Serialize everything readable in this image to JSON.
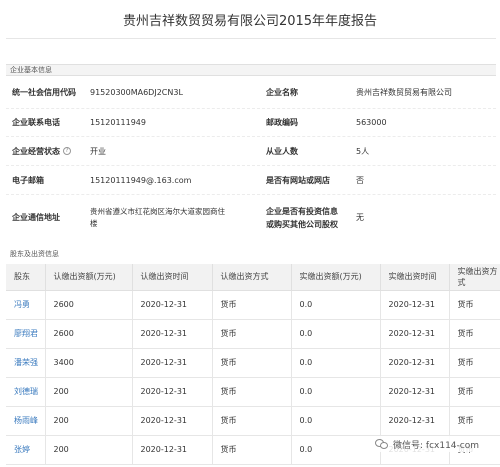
{
  "report_title": "贵州吉祥数贸贸易有限公司2015年年度报告",
  "basic": {
    "section_title": "企业基本信息",
    "credit_code_label": "统一社会信用代码",
    "credit_code_value": "91520300MA6DJ2CN3L",
    "company_name_label": "企业名称",
    "company_name_value": "贵州吉祥数贸贸易有限公司",
    "phone_label": "企业联系电话",
    "phone_value": "15120111949",
    "postcode_label": "邮政编码",
    "postcode_value": "563000",
    "status_label": "企业经营状态",
    "status_help": "?",
    "status_value": "开业",
    "employees_label": "从业人数",
    "employees_value": "5人",
    "email_label": "电子邮箱",
    "email_value": "15120111949@.163.com",
    "website_label": "是否有网站或网店",
    "website_value": "否",
    "address_label": "企业通信地址",
    "address_value_line1": "贵州省遵义市红花岗区海尔大道家园商住",
    "address_value_line2": "楼",
    "investment_label_line1": "企业是否有投资信息",
    "investment_label_line2": "或购买其他公司股权",
    "investment_value": "无"
  },
  "shareholders": {
    "section_title": "股东及出资信息",
    "headers": [
      "股东",
      "认缴出资额(万元)",
      "认缴出资时间",
      "认缴出资方式",
      "实缴出资额(万元)",
      "实缴出资时间",
      "实缴出资方式"
    ],
    "rows": [
      {
        "name": "冯勇",
        "sub_amount": "2600",
        "sub_date": "2020-12-31",
        "sub_method": "货币",
        "paid_amount": "0.0",
        "paid_date": "2020-12-31",
        "paid_method": "货币"
      },
      {
        "name": "廖翔君",
        "sub_amount": "2600",
        "sub_date": "2020-12-31",
        "sub_method": "货币",
        "paid_amount": "0.0",
        "paid_date": "2020-12-31",
        "paid_method": "货币"
      },
      {
        "name": "潘荣强",
        "sub_amount": "3400",
        "sub_date": "2020-12-31",
        "sub_method": "货币",
        "paid_amount": "0.0",
        "paid_date": "2020-12-31",
        "paid_method": "货币"
      },
      {
        "name": "刘德瑞",
        "sub_amount": "200",
        "sub_date": "2020-12-31",
        "sub_method": "货币",
        "paid_amount": "0.0",
        "paid_date": "2020-12-31",
        "paid_method": "货币"
      },
      {
        "name": "杨雨峰",
        "sub_amount": "200",
        "sub_date": "2020-12-31",
        "sub_method": "货币",
        "paid_amount": "0.0",
        "paid_date": "2020-12-31",
        "paid_method": "货币"
      },
      {
        "name": "张婷",
        "sub_amount": "200",
        "sub_date": "2020-12-31",
        "sub_method": "货币",
        "paid_amount": "0.0",
        "paid_date": "2020-12-31",
        "paid_method": "货币"
      }
    ]
  },
  "watermark": {
    "icon": "wechat-icon",
    "text": "微信号: fcx114-com"
  },
  "colors": {
    "link": "#3b7bbf",
    "section_bg": "#f4f4f4",
    "header_bg": "#f2f2f2"
  }
}
